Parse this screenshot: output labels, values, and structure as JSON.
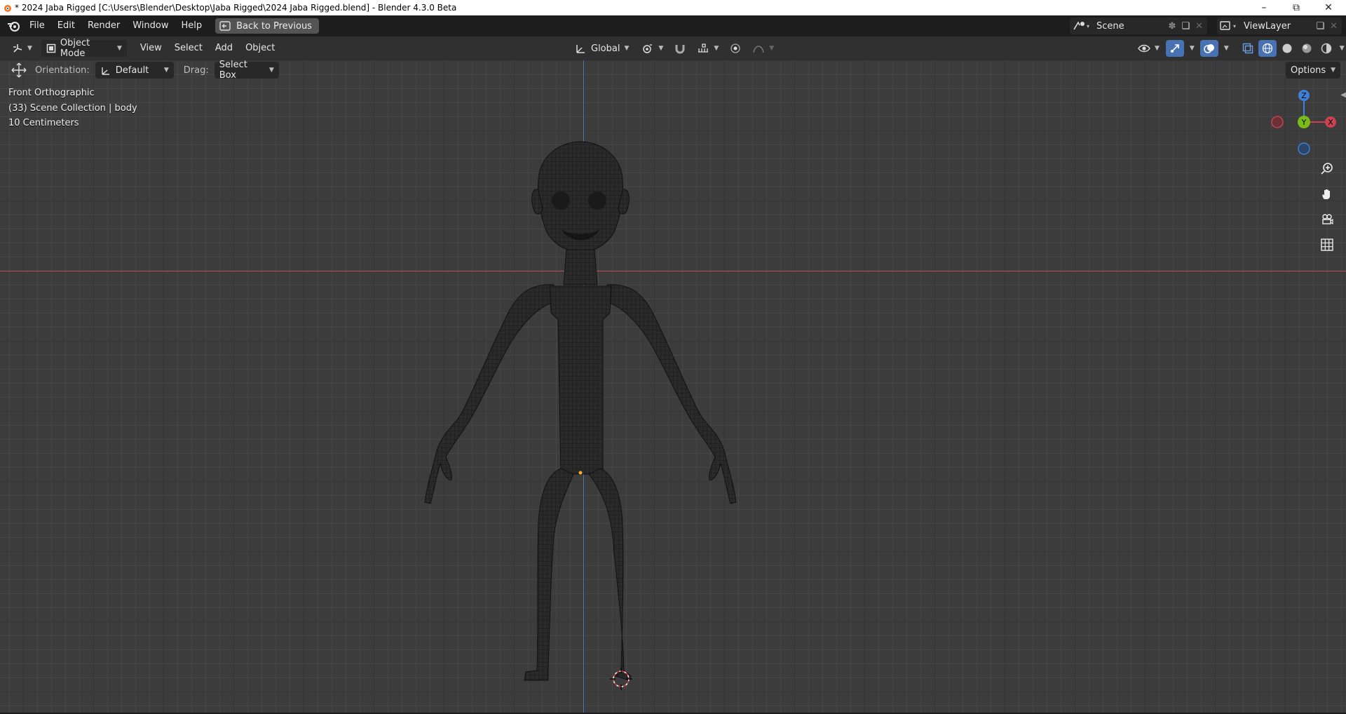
{
  "window": {
    "title": "* 2024 Jaba Rigged [C:\\Users\\Blender\\Desktop\\Jaba Rigged\\2024 Jaba Rigged.blend] - Blender 4.3.0 Beta"
  },
  "topbar": {
    "menus": [
      "File",
      "Edit",
      "Render",
      "Window",
      "Help"
    ],
    "back_label": "Back to Previous",
    "scene_name": "Scene",
    "view_layer_name": "ViewLayer"
  },
  "header": {
    "mode": "Object Mode",
    "menus": [
      "View",
      "Select",
      "Add",
      "Object"
    ],
    "transform_orientation": "Global"
  },
  "toolbar": {
    "orientation_label": "Orientation:",
    "orientation_value": "Default",
    "drag_label": "Drag:",
    "drag_value": "Select Box",
    "options_label": "Options"
  },
  "viewport": {
    "view_name": "Front Orthographic",
    "collection_info": "(33) Scene Collection | body",
    "grid_scale": "10 Centimeters",
    "gizmo_axes": {
      "z": "Z",
      "y": "Y",
      "x": "X"
    }
  },
  "colors": {
    "accent": "#4772b3",
    "x_axis": "#c9424f",
    "y_axis": "#7bbb18",
    "z_axis": "#3f80d8"
  }
}
